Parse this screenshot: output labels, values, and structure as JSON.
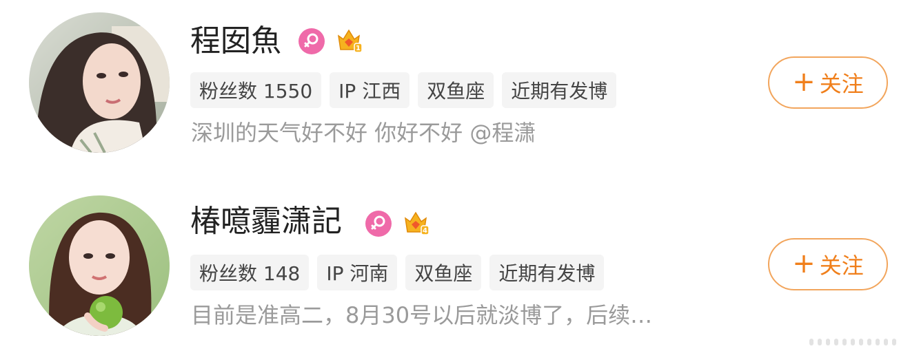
{
  "colors": {
    "follow_accent": "#f07f1b",
    "follow_border": "#f2a55c",
    "female_badge": "#ef6aa9",
    "vip_crown": "#f6b21f",
    "tag_bg": "#f4f4f4",
    "bio_text": "#9a9a9a"
  },
  "users": [
    {
      "name": "程囡魚",
      "gender_icon": "female-icon",
      "vip_icon": "crown-icon",
      "vip_level": "1",
      "tags": [
        "粉丝数 1550",
        "IP 江西",
        "双鱼座",
        "近期有发博"
      ],
      "bio": "深圳的天气好不好 你好不好 @程潇",
      "follow_plus": "+",
      "follow_label": "关注"
    },
    {
      "name": "椿噫霾潇記",
      "gender_icon": "female-icon",
      "vip_icon": "crown-icon",
      "vip_level": "4",
      "tags": [
        "粉丝数 148",
        "IP 河南",
        "双鱼座",
        "近期有发博"
      ],
      "bio": "目前是准高二，8月30号以后就淡博了，后续…",
      "follow_plus": "+",
      "follow_label": "关注"
    }
  ]
}
